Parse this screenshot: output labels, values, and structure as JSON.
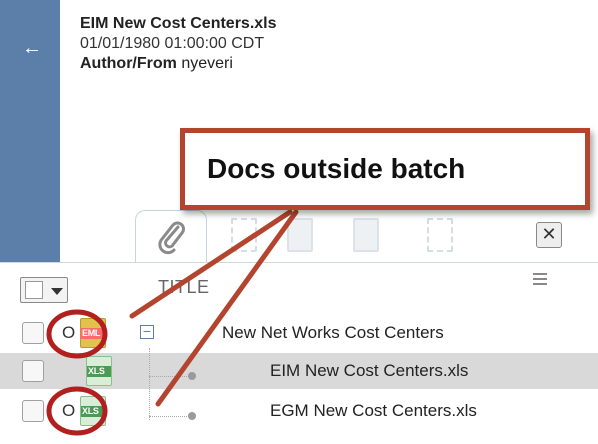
{
  "doc": {
    "title": "EIM New Cost Centers.xls",
    "date": "01/01/1980 01:00:00 CDT",
    "author_label": "Author/From",
    "author_value": "nyeveri"
  },
  "toolbar": {
    "back_icon": "left-arrow-icon",
    "attach_icon": "paperclip-icon",
    "close_label": "✕"
  },
  "grid": {
    "title_header": "TITLE",
    "rows": [
      {
        "prefix": "O",
        "file_tag": "EML",
        "expander": "−",
        "label": "New Net Works Cost Centers"
      },
      {
        "prefix": "",
        "file_tag": "XLS",
        "label": "EIM New Cost Centers.xls"
      },
      {
        "prefix": "O",
        "file_tag": "XLS",
        "label": "EGM New Cost Centers.xls"
      }
    ]
  },
  "callout": {
    "text": "Docs outside batch"
  },
  "colors": {
    "rail": "#5b7fa8",
    "annotation": "#b3452f",
    "selected_row": "#d9d9d9"
  }
}
